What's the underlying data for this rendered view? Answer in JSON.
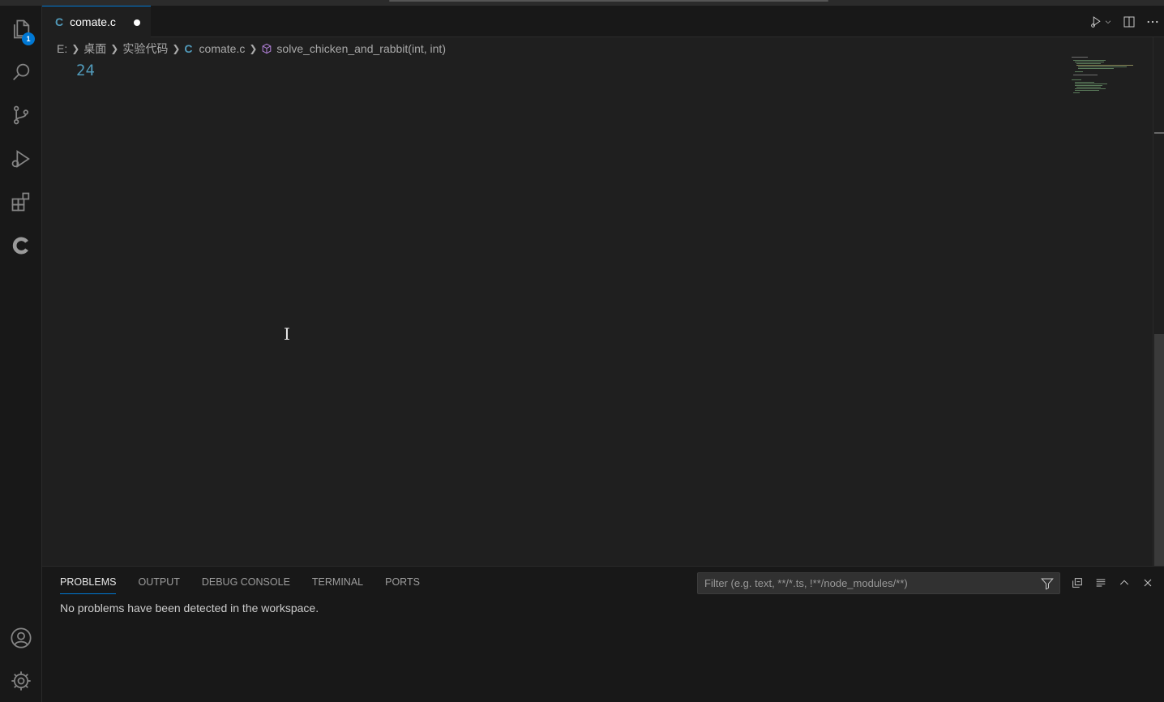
{
  "editor": {
    "tab": {
      "icon": "C",
      "name": "comate.c"
    },
    "breadcrumb": {
      "drive": "E:",
      "folder1": "桌面",
      "folder2": "实验代码",
      "file_icon": "C",
      "file": "comate.c",
      "symbol": "solve_chicken_and_rabbit(int, int)"
    },
    "line_number": "24"
  },
  "activity_bar": {
    "explorer_badge": "1",
    "items": [
      "files-icon",
      "search-icon",
      "source-control-icon",
      "run-debug-icon",
      "extensions-icon",
      "comate-icon",
      "account-icon",
      "settings-gear-icon"
    ]
  },
  "panel": {
    "tabs": [
      "PROBLEMS",
      "OUTPUT",
      "DEBUG CONSOLE",
      "TERMINAL",
      "PORTS"
    ],
    "filter_placeholder": "Filter (e.g. text, **/*.ts, !**/node_modules/**)",
    "message": "No problems have been detected in the workspace."
  },
  "colors": {
    "accent": "#0078d4",
    "c_icon": "#519aba",
    "background": "#1f1f1f"
  }
}
